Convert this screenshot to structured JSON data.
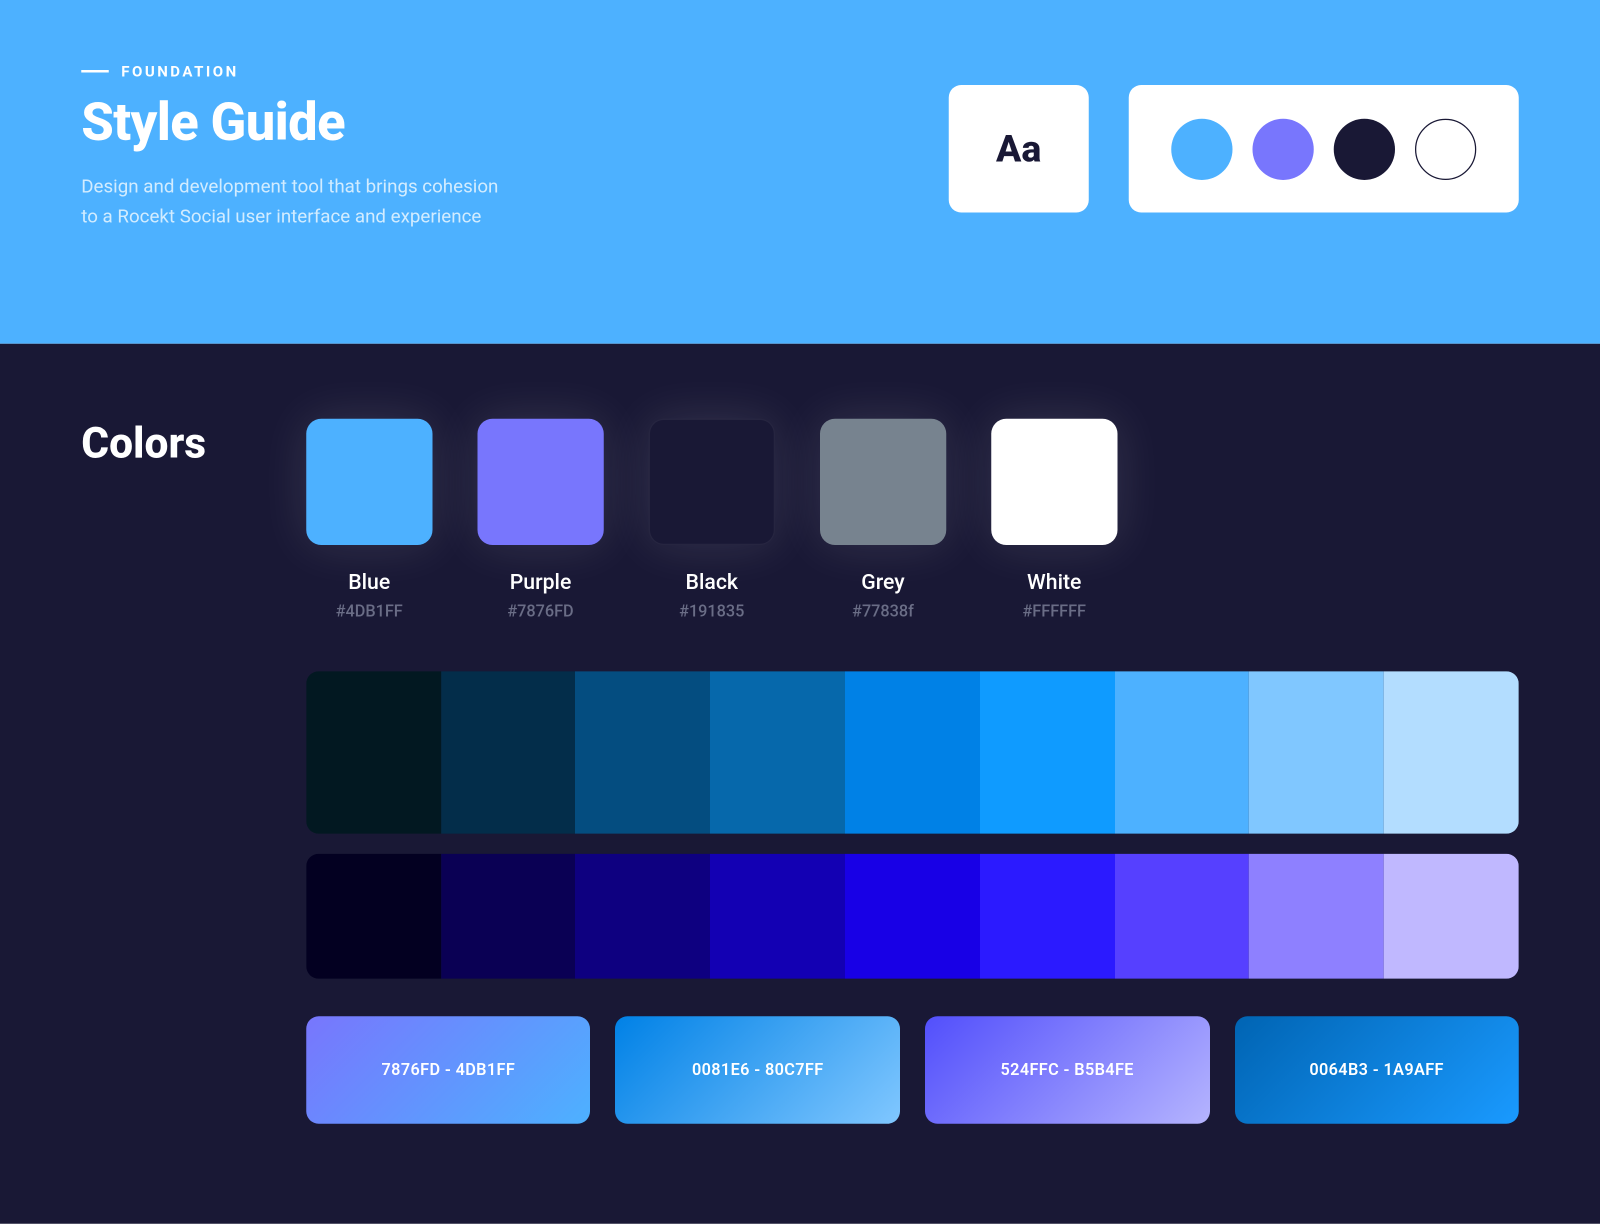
{
  "hero": {
    "eyebrow": "FOUNDATION",
    "title": "Style Guide",
    "description": "Design and development tool that brings cohesion to a Rocekt Social user interface and experience",
    "aa": "Aa",
    "palette_dots": [
      "#4DB1FF",
      "#7876FD",
      "#191835",
      "#FFFFFF"
    ]
  },
  "colors_section": {
    "heading": "Colors",
    "swatches": [
      {
        "name": "Blue",
        "hex": "#4DB1FF"
      },
      {
        "name": "Purple",
        "hex": "#7876FD"
      },
      {
        "name": "Black",
        "hex": "#191835"
      },
      {
        "name": "Grey",
        "hex": "#77838f"
      },
      {
        "name": "White",
        "hex": "#FFFFFF"
      }
    ],
    "scale_blue": [
      "#021821",
      "#032D4A",
      "#044D80",
      "#0668AB",
      "#0081E6",
      "#0F9BFF",
      "#4DB1FF",
      "#80C7FF",
      "#B3DDFF"
    ],
    "scale_purple": [
      "#030021",
      "#0A0054",
      "#0E0080",
      "#1300B3",
      "#1800E6",
      "#2B1AFF",
      "#5640FF",
      "#8E80FF",
      "#C0B8FF"
    ],
    "gradients": [
      {
        "label": "7876FD - 4DB1FF",
        "from": "#7876FD",
        "to": "#4DB1FF"
      },
      {
        "label": "0081E6 - 80C7FF",
        "from": "#0081E6",
        "to": "#80C7FF"
      },
      {
        "label": "524FFC - B5B4FE",
        "from": "#524FFC",
        "to": "#B5B4FE"
      },
      {
        "label": "0064B3 - 1A9AFF",
        "from": "#0064B3",
        "to": "#1A9AFF"
      }
    ]
  }
}
